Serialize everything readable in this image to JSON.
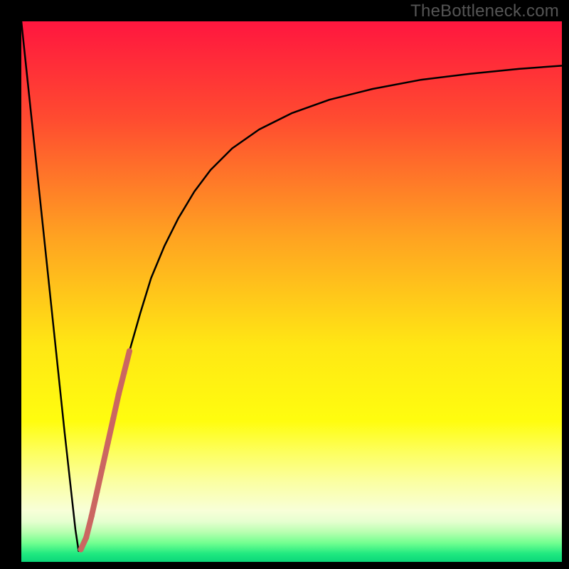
{
  "watermark": "TheBottleneck.com",
  "chart_data": {
    "type": "line",
    "title": "",
    "xlabel": "",
    "ylabel": "",
    "xlim": [
      0,
      100
    ],
    "ylim": [
      0,
      100
    ],
    "grid": false,
    "legend": false,
    "gradient_stops": [
      {
        "offset": 0.0,
        "color": "#ff163f"
      },
      {
        "offset": 0.18,
        "color": "#ff4b30"
      },
      {
        "offset": 0.4,
        "color": "#ffa321"
      },
      {
        "offset": 0.6,
        "color": "#ffe714"
      },
      {
        "offset": 0.74,
        "color": "#fffd0f"
      },
      {
        "offset": 0.8,
        "color": "#fdff62"
      },
      {
        "offset": 0.85,
        "color": "#fbffa0"
      },
      {
        "offset": 0.905,
        "color": "#f8ffd8"
      },
      {
        "offset": 0.925,
        "color": "#e6ffd0"
      },
      {
        "offset": 0.945,
        "color": "#b8ffb0"
      },
      {
        "offset": 0.965,
        "color": "#72ff90"
      },
      {
        "offset": 0.985,
        "color": "#20e980"
      },
      {
        "offset": 1.0,
        "color": "#0bd679"
      }
    ],
    "series": [
      {
        "name": "bottleneck-curve",
        "stroke": "#000000",
        "stroke_width": 2.5,
        "x": [
          0.0,
          2.0,
          4.0,
          6.0,
          8.0,
          10.0,
          10.6,
          11.3,
          12.5,
          14.0,
          16.0,
          18.0,
          20.0,
          22.0,
          24.0,
          26.5,
          29.0,
          32.0,
          35.0,
          39.0,
          44.0,
          50.0,
          57.0,
          65.0,
          74.0,
          83.0,
          92.0,
          100.0
        ],
        "y": [
          100.0,
          81.0,
          62.0,
          43.0,
          24.0,
          6.0,
          2.0,
          2.5,
          6.0,
          13.0,
          22.0,
          31.0,
          39.0,
          46.0,
          52.5,
          58.5,
          63.5,
          68.5,
          72.5,
          76.5,
          80.0,
          83.0,
          85.5,
          87.5,
          89.2,
          90.3,
          91.2,
          91.8
        ]
      },
      {
        "name": "highlight-segment",
        "stroke": "#cb6661",
        "stroke_width": 8,
        "x": [
          11.0,
          12.0,
          13.0,
          14.0,
          15.0,
          16.0,
          17.0,
          18.0,
          19.0,
          20.0
        ],
        "y": [
          2.3,
          4.5,
          8.5,
          13.0,
          17.5,
          22.0,
          26.5,
          31.0,
          35.0,
          39.0
        ]
      }
    ]
  }
}
